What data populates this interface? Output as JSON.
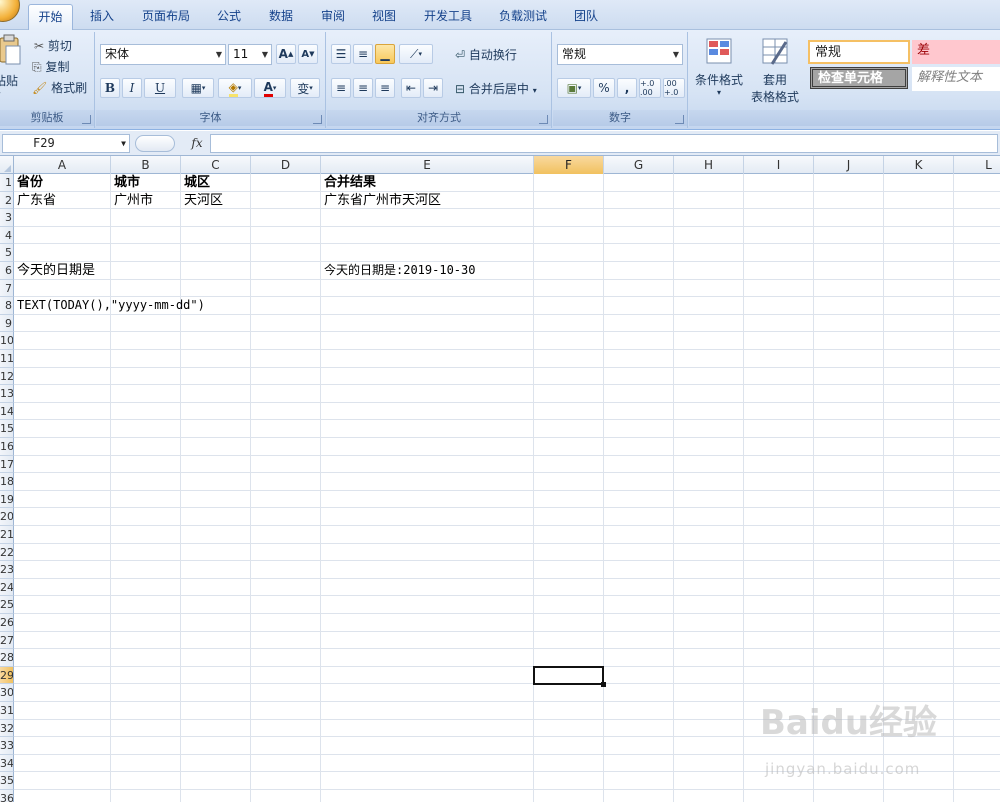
{
  "tabs": [
    "开始",
    "插入",
    "页面布局",
    "公式",
    "数据",
    "审阅",
    "视图",
    "开发工具",
    "负载测试",
    "团队"
  ],
  "active_tab": "开始",
  "ribbon": {
    "clipboard": {
      "paste": "粘贴",
      "cut": "剪切",
      "copy": "复制",
      "format_painter": "格式刷",
      "label": "剪贴板"
    },
    "font": {
      "name": "宋体",
      "size": "11",
      "grow": "A",
      "shrink": "A",
      "bold": "B",
      "italic": "I",
      "underline": "U",
      "phonetic": "变",
      "label": "字体"
    },
    "alignment": {
      "wrap": "自动换行",
      "merge": "合并后居中",
      "label": "对齐方式"
    },
    "number": {
      "format": "常规",
      "percent": "%",
      "comma": ",",
      "inc_dec": "+.0 .00",
      "dec_dec": ".00 +.0",
      "label": "数字"
    },
    "styles": {
      "conditional": "条件格式",
      "table_format_1": "套用",
      "table_format_2": "表格格式",
      "normal": "常规",
      "bad": "差",
      "check_cell": "检查单元格",
      "explanatory": "解释性文本"
    }
  },
  "formula_bar": {
    "name_box": "F29",
    "fx": "fx",
    "formula": ""
  },
  "columns": [
    "A",
    "B",
    "C",
    "D",
    "E",
    "F",
    "G",
    "H",
    "I",
    "J",
    "K",
    "L"
  ],
  "selected_column": "F",
  "rows": [
    "1",
    "2",
    "3",
    "4",
    "5",
    "6",
    "7",
    "8",
    "9",
    "10",
    "11",
    "12",
    "13",
    "14",
    "15",
    "16",
    "17",
    "18",
    "19",
    "20",
    "21",
    "22",
    "23",
    "24",
    "25",
    "26",
    "27",
    "28",
    "29",
    "30",
    "31",
    "32",
    "33",
    "34",
    "35",
    "36"
  ],
  "selected_row": "29",
  "cells": {
    "A1": "省份",
    "B1": "城市",
    "C1": "城区",
    "E1": "合并结果",
    "A2": "广东省",
    "B2": "广州市",
    "C2": "天河区",
    "E2": "广东省广州市天河区",
    "A6": "今天的日期是",
    "E6": "今天的日期是:2019-10-30",
    "A8": "TEXT(TODAY(),\"yyyy-mm-dd\")"
  },
  "watermark": {
    "text": "Baidu经验",
    "url": "jingyan.baidu.com"
  },
  "colors": {
    "accent": "#15428b",
    "selected_header": "#f1c15f",
    "ribbon_bg": "#d6e3f4",
    "bad_style_bg": "#ffc7ce",
    "bad_style_text": "#9c0006",
    "check_cell_bg": "#a5a5a5"
  }
}
